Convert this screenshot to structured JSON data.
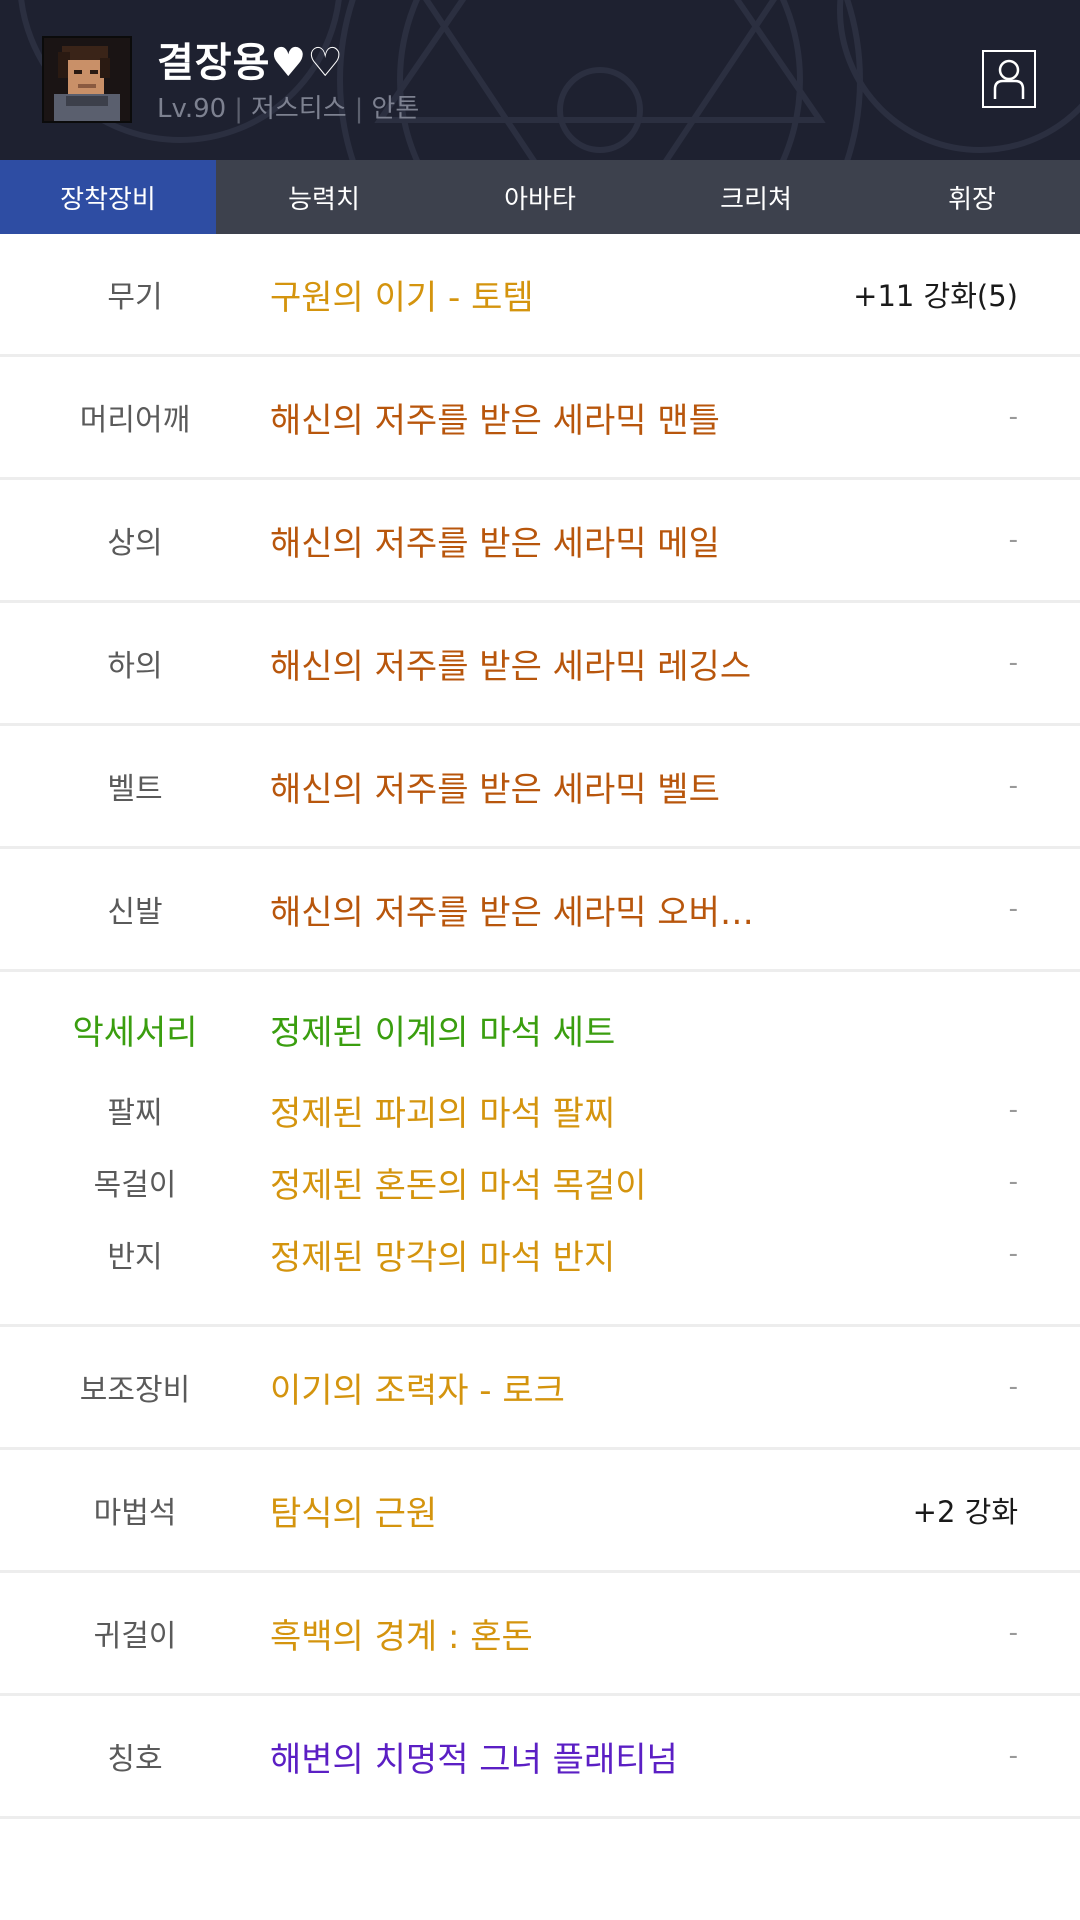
{
  "colors": {
    "header_bg": "#1e2130",
    "tab_bar": "#3d414d",
    "tab_active": "#2e4da3",
    "epic": "#b8560c",
    "unique": "#d4940e",
    "set": "#3a9e0f",
    "title_purple": "#5b1fc4"
  },
  "character": {
    "name": "결장용♥♡",
    "level": "Lv.90",
    "class": "저스티스",
    "server": "안톤",
    "avatar_icon": "character-portrait-icon",
    "profile_icon": "user-profile-icon"
  },
  "tabs": [
    {
      "label": "장착장비",
      "active": true
    },
    {
      "label": "능력치",
      "active": false
    },
    {
      "label": "아바타",
      "active": false
    },
    {
      "label": "크리쳐",
      "active": false
    },
    {
      "label": "휘장",
      "active": false
    }
  ],
  "equipment": [
    {
      "slot": "무기",
      "item": "구원의 이기 - 토템",
      "rarity_color": "#d4940e",
      "value": "+11 강화(5)"
    },
    {
      "slot": "머리어깨",
      "item": "해신의 저주를 받은 세라믹 맨틀",
      "rarity_color": "#b8560c",
      "value": "-"
    },
    {
      "slot": "상의",
      "item": "해신의 저주를 받은 세라믹 메일",
      "rarity_color": "#b8560c",
      "value": "-"
    },
    {
      "slot": "하의",
      "item": "해신의 저주를 받은 세라믹 레깅스",
      "rarity_color": "#b8560c",
      "value": "-"
    },
    {
      "slot": "벨트",
      "item": "해신의 저주를 받은 세라믹 벨트",
      "rarity_color": "#b8560c",
      "value": "-"
    },
    {
      "slot": "신발",
      "item": "해신의 저주를 받은 세라믹 오버…",
      "rarity_color": "#b8560c",
      "value": "-"
    }
  ],
  "accessories": {
    "heading_label": "악세서리",
    "set_name": "정제된 이계의 마석 세트",
    "items": [
      {
        "slot": "팔찌",
        "item": "정제된 파괴의 마석 팔찌",
        "value": "-"
      },
      {
        "slot": "목걸이",
        "item": "정제된 혼돈의 마석 목걸이",
        "value": "-"
      },
      {
        "slot": "반지",
        "item": "정제된 망각의 마석 반지",
        "value": "-"
      }
    ]
  },
  "extras": [
    {
      "slot": "보조장비",
      "item": "이기의 조력자 - 로크",
      "rarity_color": "#d4940e",
      "value": "-"
    },
    {
      "slot": "마법석",
      "item": "탐식의 근원",
      "rarity_color": "#d4940e",
      "value": "+2 강화"
    },
    {
      "slot": "귀걸이",
      "item": "흑백의 경계 : 혼돈",
      "rarity_color": "#d4940e",
      "value": "-"
    },
    {
      "slot": "칭호",
      "item": "해변의 치명적 그녀 플래티넘",
      "rarity_color": "#5b1fc4",
      "value": "-"
    }
  ]
}
